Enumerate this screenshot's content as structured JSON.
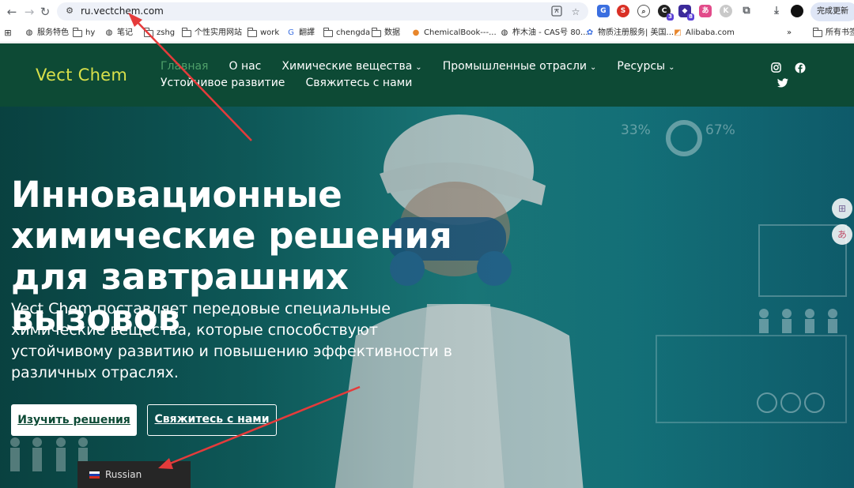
{
  "browser": {
    "url": "ru.vectchem.com",
    "update_button": "完成更新",
    "ext_badge_1": "3",
    "ext_badge_2": "8",
    "bookmarks": [
      {
        "label": "服务特色"
      },
      {
        "label": "hy"
      },
      {
        "label": "笔记"
      },
      {
        "label": "zshg"
      },
      {
        "label": "个性实用网站"
      },
      {
        "label": "work"
      },
      {
        "label": "翻譯"
      },
      {
        "label": "chengda"
      },
      {
        "label": "数据"
      },
      {
        "label": "ChemicalBook---..."
      },
      {
        "label": "柞木油 - CAS号 80..."
      },
      {
        "label": "物质注册服务| 美国..."
      },
      {
        "label": "Alibaba.com"
      },
      {
        "label": "所有书签"
      }
    ],
    "more_bookmarks": "»"
  },
  "site": {
    "logo": "Vect Chem",
    "nav": [
      {
        "label": "Главная",
        "active": true
      },
      {
        "label": "О нас"
      },
      {
        "label": "Химические вещества",
        "dropdown": true
      },
      {
        "label": "Промышленные отрасли",
        "dropdown": true
      },
      {
        "label": "Ресурсы",
        "dropdown": true
      },
      {
        "label": "Устойчивое развитие"
      },
      {
        "label": "Свяжитесь с нами"
      }
    ],
    "caret": "⌄",
    "brand_color": "#0d4a35",
    "logo_color": "#d8e04a",
    "active_nav_color": "#4fa06a"
  },
  "hero": {
    "title": "Инновационные химические решения для завтрашних вызовов",
    "subtitle": "Vect Chem поставляет передовые специальные химические вещества, которые способствуют устойчивому развитию и повышению эффективности в различных отраслях.",
    "primary_button": "Изучить решения",
    "secondary_button": "Свяжитесь с нами",
    "stat_1": "33%",
    "stat_2": "67%"
  },
  "language_switcher": {
    "label": "Russian"
  },
  "icons": {
    "back": "back-arrow-icon",
    "forward": "forward-arrow-icon",
    "reload": "reload-icon",
    "social": [
      "instagram-icon",
      "facebook-icon",
      "twitter-icon"
    ]
  }
}
